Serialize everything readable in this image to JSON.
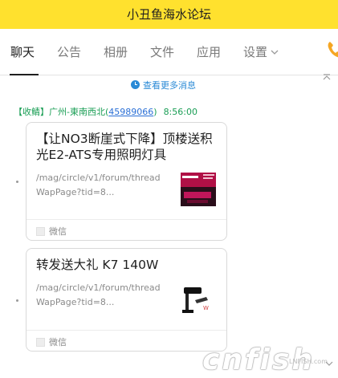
{
  "app": {
    "title": "小丑鱼海水论坛"
  },
  "tabs": [
    {
      "label": "聊天",
      "active": true
    },
    {
      "label": "公告"
    },
    {
      "label": "相册"
    },
    {
      "label": "文件"
    },
    {
      "label": "应用"
    },
    {
      "label": "设置"
    }
  ],
  "chat": {
    "more_messages": "查看更多消息",
    "sender": {
      "name": "【收鲭】广州-東南西北",
      "qq": "45989066",
      "time": "8:56:00"
    },
    "cards": [
      {
        "title": "【让NO3断崖式下降】顶楼送积光E2-ATS专用照明灯具",
        "url": "/mag/circle/v1/forum/threadWapPage?tid=8...",
        "source": "微信",
        "thumb_icon": "light-fixture-product-thumbnail"
      },
      {
        "title": "转发送大礼 K7 140W",
        "url": "/mag/circle/v1/forum/threadWapPage?tid=8...",
        "source": "微信",
        "thumb_icon": "black-lamp-product-thumbnail"
      }
    ]
  },
  "watermark": {
    "text": "cnfish",
    "sub": "LNFISH.com"
  },
  "colors": {
    "title_bar": "#ffe12e",
    "link": "#2a8ad6",
    "sender": "#1a9e55"
  }
}
